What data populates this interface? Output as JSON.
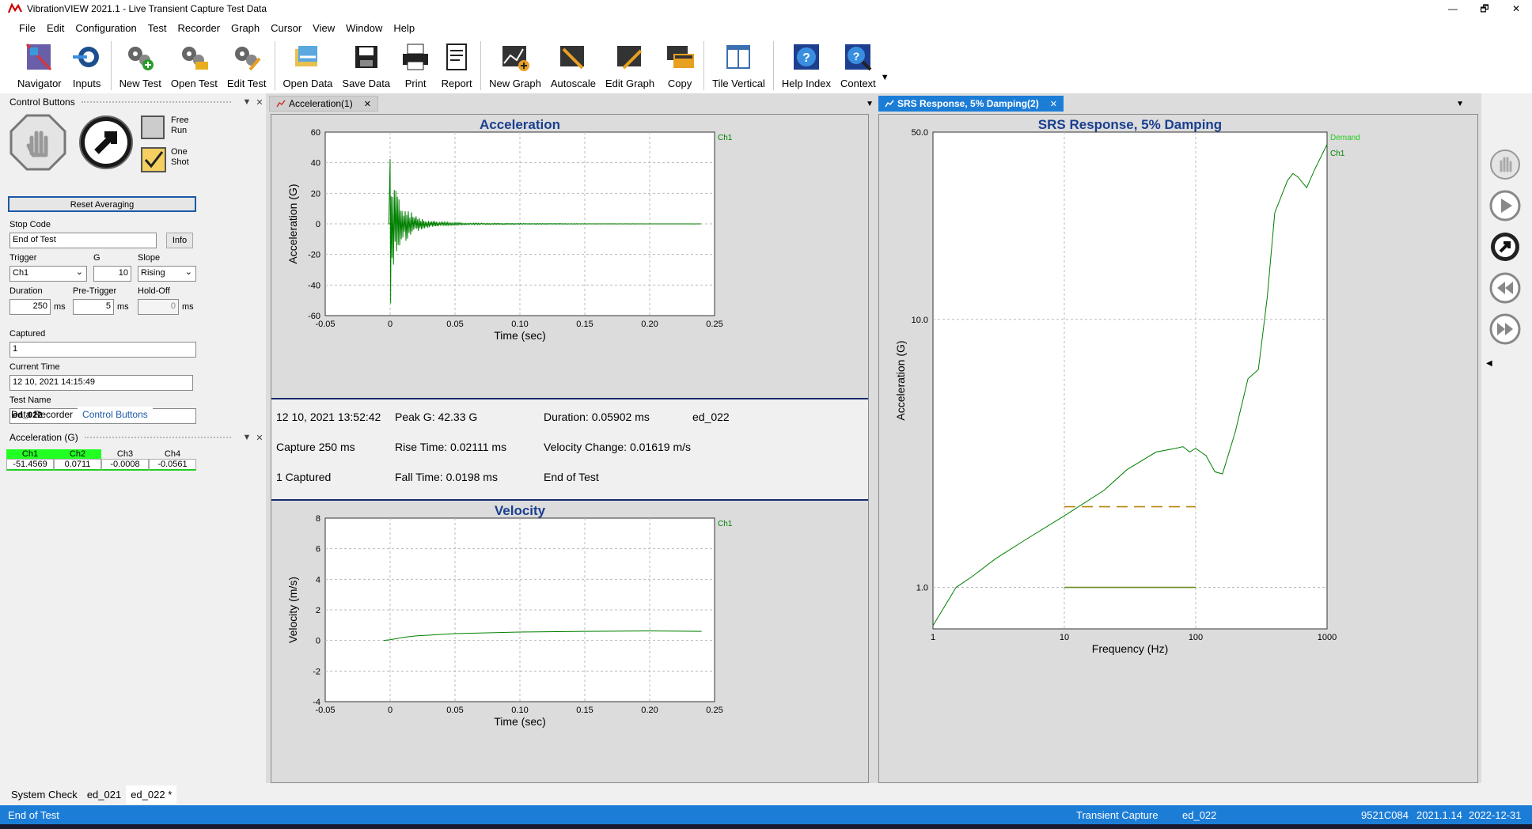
{
  "window": {
    "title": "VibrationVIEW 2021.1 - Live Transient Capture Test Data",
    "controls": [
      "—",
      "🗗",
      "✕"
    ]
  },
  "menu": [
    "File",
    "Edit",
    "Configuration",
    "Test",
    "Recorder",
    "Graph",
    "Cursor",
    "View",
    "Window",
    "Help"
  ],
  "toolbar": [
    {
      "label": "Navigator",
      "icon": "navigator-icon"
    },
    {
      "label": "Inputs",
      "icon": "inputs-icon"
    },
    {
      "label": "New Test",
      "icon": "new-test-icon"
    },
    {
      "label": "Open Test",
      "icon": "open-test-icon"
    },
    {
      "label": "Edit Test",
      "icon": "edit-test-icon"
    },
    {
      "label": "Open Data",
      "icon": "open-data-icon"
    },
    {
      "label": "Save Data",
      "icon": "save-data-icon"
    },
    {
      "label": "Print",
      "icon": "print-icon"
    },
    {
      "label": "Report",
      "icon": "report-icon"
    },
    {
      "label": "New Graph",
      "icon": "new-graph-icon"
    },
    {
      "label": "Autoscale",
      "icon": "autoscale-icon"
    },
    {
      "label": "Edit Graph",
      "icon": "edit-graph-icon"
    },
    {
      "label": "Copy",
      "icon": "copy-icon"
    },
    {
      "label": "Tile Vertical",
      "icon": "tile-vertical-icon"
    },
    {
      "label": "Help Index",
      "icon": "help-index-icon"
    },
    {
      "label": "Context",
      "icon": "context-help-icon"
    }
  ],
  "control_panel": {
    "title": "Control Buttons",
    "free_run": "Free Run",
    "one_shot": "One Shot",
    "reset_averaging": "Reset Averaging",
    "stop_code_label": "Stop Code",
    "stop_code_value": "End of Test",
    "info_button": "Info",
    "trigger_label": "Trigger",
    "trigger_value": "Ch1",
    "g_label": "G",
    "g_value": "10",
    "slope_label": "Slope",
    "slope_value": "Rising",
    "duration_label": "Duration",
    "duration_value": "250",
    "duration_unit": "ms",
    "pretrigger_label": "Pre-Trigger",
    "pretrigger_value": "5",
    "pretrigger_unit": "ms",
    "holdoff_label": "Hold-Off",
    "holdoff_value": "0",
    "holdoff_unit": "ms",
    "captured_label": "Captured",
    "captured_value": "1",
    "current_time_label": "Current Time",
    "current_time_value": "12 10, 2021 14:15:49",
    "test_name_label": "Test Name",
    "test_name_value": "ed_022"
  },
  "left_tabs": [
    "Data Recorder",
    "Control Buttons"
  ],
  "channel_panel": {
    "title": "Acceleration (G)",
    "headers": [
      "Ch1",
      "Ch2",
      "Ch3",
      "Ch4"
    ],
    "values": [
      "-51.4569",
      "0.0711",
      "-0.0008",
      "-0.0561"
    ],
    "active_color": "#22ff22"
  },
  "doc_tabs": {
    "left": "Acceleration(1)",
    "right": "SRS Response, 5% Damping(2)"
  },
  "accel_chart": {
    "title": "Acceleration",
    "xlabel": "Time (sec)",
    "ylabel": "Acceleration (G)",
    "legend": "Ch1",
    "xticks": [
      "-0.05",
      "0",
      "0.05",
      "0.10",
      "0.15",
      "0.20",
      "0.25"
    ],
    "yticks": [
      "60",
      "40",
      "20",
      "0",
      "-20",
      "-40",
      "-60"
    ]
  },
  "info": {
    "date": "12 10, 2021 13:52:42",
    "peak": "Peak G: 42.33 G",
    "duration": "Duration: 0.05902 ms",
    "name": "ed_022",
    "capture": "Capture 250 ms",
    "rise": "Rise Time: 0.02111 ms",
    "velocity_change": "Velocity Change: 0.01619 m/s",
    "captured": "1 Captured",
    "fall": "Fall Time: 0.0198 ms",
    "status": "End of Test"
  },
  "vel_chart": {
    "title": "Velocity",
    "xlabel": "Time (sec)",
    "ylabel": "Velocity (m/s)",
    "legend": "Ch1",
    "xticks": [
      "-0.05",
      "0",
      "0.05",
      "0.10",
      "0.15",
      "0.20",
      "0.25"
    ],
    "yticks": [
      "8",
      "6",
      "4",
      "2",
      "0",
      "-2",
      "-4"
    ]
  },
  "srs_chart": {
    "title": "SRS Response, 5% Damping",
    "xlabel": "Frequency (Hz)",
    "ylabel": "Acceleration (G)",
    "legend": [
      "Demand",
      "Ch1"
    ],
    "xticks": [
      "1",
      "10",
      "100",
      "1000"
    ],
    "yticks": [
      "50.0",
      "10.0",
      "1.0"
    ]
  },
  "chart_data": [
    {
      "type": "line",
      "title": "Acceleration",
      "xlabel": "Time (sec)",
      "ylabel": "Acceleration (G)",
      "xlim": [
        -0.05,
        0.25
      ],
      "ylim": [
        -60,
        60
      ],
      "grid": true,
      "legend": "top-right",
      "series": [
        {
          "name": "Ch1",
          "color": "#008000",
          "peak": 42.33,
          "x": [
            -0.05,
            -0.001,
            0,
            0.0005,
            0.001,
            0.002,
            0.004,
            0.006,
            0.01,
            0.02,
            0.05,
            0.1,
            0.24
          ],
          "y": [
            0,
            0,
            42,
            -52,
            30,
            -30,
            18,
            -14,
            8,
            3,
            0.5,
            0.2,
            0
          ]
        }
      ]
    },
    {
      "type": "line",
      "title": "Velocity",
      "xlabel": "Time (sec)",
      "ylabel": "Velocity (m/s)",
      "xlim": [
        -0.05,
        0.25
      ],
      "ylim": [
        -4,
        8
      ],
      "grid": true,
      "legend": "top-right",
      "series": [
        {
          "name": "Ch1",
          "color": "#008000",
          "x": [
            -0.005,
            0,
            0.01,
            0.02,
            0.05,
            0.1,
            0.15,
            0.2,
            0.24
          ],
          "y": [
            0,
            0.05,
            0.2,
            0.3,
            0.45,
            0.55,
            0.6,
            0.62,
            0.6
          ]
        }
      ]
    },
    {
      "type": "line",
      "title": "SRS Response, 5% Damping",
      "xlabel": "Frequency (Hz)",
      "ylabel": "Acceleration (G)",
      "xscale": "log",
      "yscale": "log",
      "xlim": [
        1,
        1000
      ],
      "ylim": [
        0.7,
        50
      ],
      "grid": true,
      "legend": "top-right",
      "series": [
        {
          "name": "Ch1",
          "color": "#008000",
          "x": [
            1,
            1.5,
            2,
            3,
            5,
            10,
            20,
            30,
            50,
            70,
            80,
            90,
            100,
            120,
            140,
            160,
            200,
            250,
            300,
            350,
            400,
            500,
            550,
            600,
            700,
            800,
            1000
          ],
          "y": [
            0.72,
            1.0,
            1.1,
            1.28,
            1.5,
            1.85,
            2.3,
            2.75,
            3.2,
            3.3,
            3.35,
            3.2,
            3.3,
            3.1,
            2.7,
            2.65,
            3.8,
            6.0,
            6.5,
            12,
            25,
            33,
            35,
            34,
            31,
            36,
            45
          ]
        },
        {
          "name": "Demand",
          "color": "#6b8e23",
          "style": "solid",
          "x": [
            10,
            100
          ],
          "y": [
            1.0,
            1.0
          ]
        },
        {
          "name": "Demand limit",
          "color": "#b8860b",
          "style": "dashed",
          "x": [
            10,
            100
          ],
          "y": [
            2.0,
            2.0
          ]
        }
      ]
    }
  ],
  "bottom_tabs": [
    "System Check",
    "ed_021",
    "ed_022 *"
  ],
  "status": {
    "left": "End of Test",
    "mode": "Transient Capture",
    "test": "ed_022",
    "serial": "9521C084",
    "version": "2021.1.14",
    "date": "2022-12-31"
  }
}
